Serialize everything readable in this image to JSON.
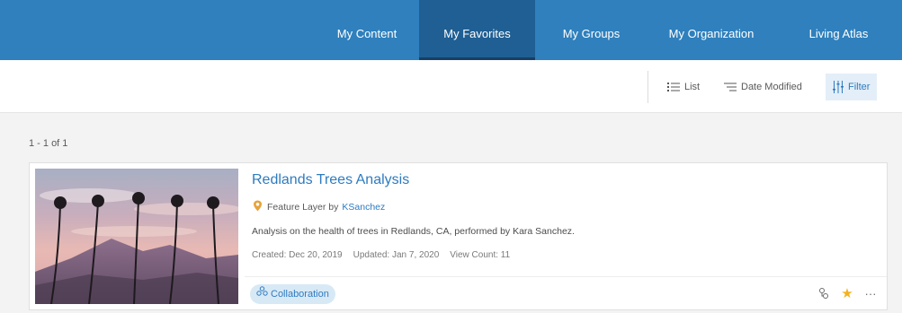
{
  "nav": {
    "tabs": [
      {
        "label": "My Content"
      },
      {
        "label": "My Favorites",
        "active": true
      },
      {
        "label": "My Groups"
      },
      {
        "label": "My Organization"
      },
      {
        "label": "Living Atlas"
      }
    ]
  },
  "toolbar": {
    "list_label": "List",
    "sort_label": "Date Modified",
    "filter_label": "Filter"
  },
  "results": {
    "count_label": "1 - 1 of 1"
  },
  "item": {
    "title": "Redlands Trees Analysis",
    "type_prefix": "Feature Layer by",
    "owner": "KSanchez",
    "description": "Analysis on the health of trees in Redlands, CA, performed by Kara Sanchez.",
    "created": "Created: Dec 20, 2019",
    "updated": "Updated: Jan 7, 2020",
    "views": "View Count: 11",
    "tag": "Collaboration"
  },
  "icons": {
    "type": "feature-layer-icon",
    "tag": "group-icon",
    "share": "shared-update-icon",
    "favorite": "star-icon",
    "more": "more-options-icon"
  },
  "colors": {
    "nav_bg": "#2f80bd",
    "nav_active": "#1f5f93",
    "link": "#2e7bbf",
    "favorite": "#f2b21c"
  }
}
